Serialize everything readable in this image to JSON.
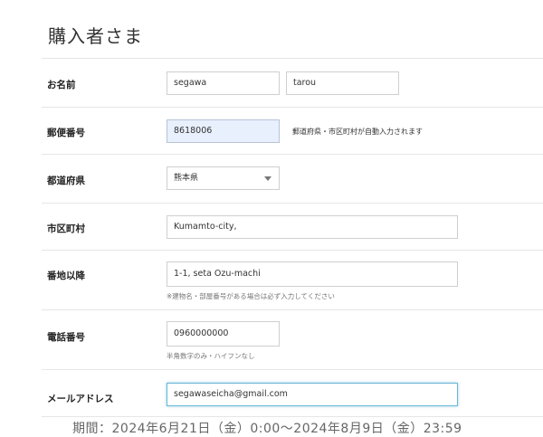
{
  "header": {
    "partial_heading": "· · · ·   · · ·",
    "title": "購入者さま"
  },
  "form": {
    "name": {
      "label": "お名前",
      "last_name": "segawa",
      "first_name": "tarou"
    },
    "postal_code": {
      "label": "郵便番号",
      "value": "8618006",
      "note": "郵道府県・市区町村が自動入力されます"
    },
    "prefecture": {
      "label": "都道府県",
      "selected": "熊本県"
    },
    "city": {
      "label": "市区町村",
      "value": "Kumamto-city,"
    },
    "address": {
      "label": "番地以降",
      "value": "1-1, seta Ozu-machi",
      "note": "※建物名・部屋番号がある場合は必ず入力してください"
    },
    "phone": {
      "label": "電話番号",
      "value": "0960000000",
      "note": "半角数字のみ・ハイフンなし"
    },
    "email": {
      "label": "メールアドレス",
      "value": "segawaseicha@gmail.com"
    }
  },
  "footer": {
    "period_text": "期間：2024年6月21日（金）0:00〜2024年8月9日（金）23:59"
  }
}
